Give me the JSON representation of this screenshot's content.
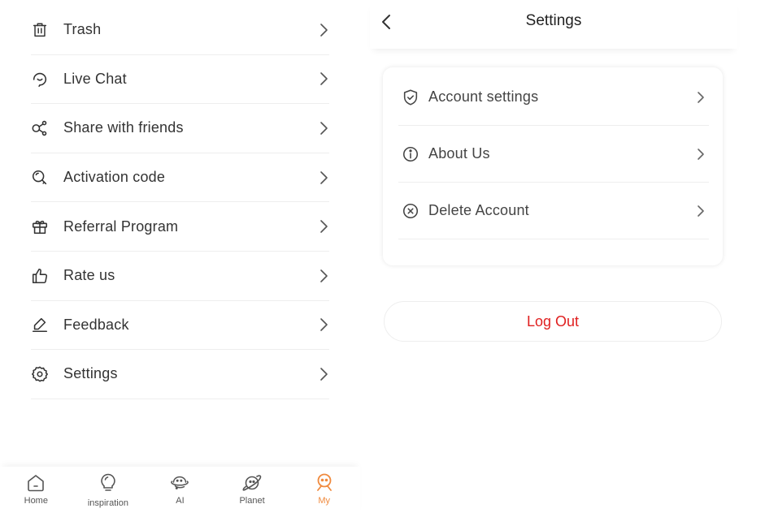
{
  "menu": {
    "items": [
      {
        "label": "Trash",
        "icon": "trash-icon"
      },
      {
        "label": "Live Chat",
        "icon": "headset-icon"
      },
      {
        "label": "Share with friends",
        "icon": "share-icon"
      },
      {
        "label": "Activation code",
        "icon": "key-search-icon"
      },
      {
        "label": "Referral Program",
        "icon": "gift-icon"
      },
      {
        "label": "Rate us",
        "icon": "thumbs-up-icon"
      },
      {
        "label": "Feedback",
        "icon": "pen-icon"
      },
      {
        "label": "Settings",
        "icon": "gear-icon"
      }
    ]
  },
  "bottom_nav": {
    "items": [
      {
        "label": "Home",
        "icon": "home-icon",
        "active": false
      },
      {
        "label": "inspiration",
        "icon": "lightbulb-icon",
        "active": false
      },
      {
        "label": "AI",
        "icon": "ai-planet-icon",
        "active": false
      },
      {
        "label": "Planet",
        "icon": "planet-icon",
        "active": false
      },
      {
        "label": "My",
        "icon": "profile-face-icon",
        "active": true
      }
    ],
    "active_color": "#f08a3e"
  },
  "settings": {
    "title": "Settings",
    "items": [
      {
        "label": "Account settings",
        "icon": "shield-check-icon"
      },
      {
        "label": "About Us",
        "icon": "info-icon"
      },
      {
        "label": "Delete Account",
        "icon": "circle-x-icon"
      }
    ],
    "logout_label": "Log Out",
    "logout_color": "#e02020"
  }
}
